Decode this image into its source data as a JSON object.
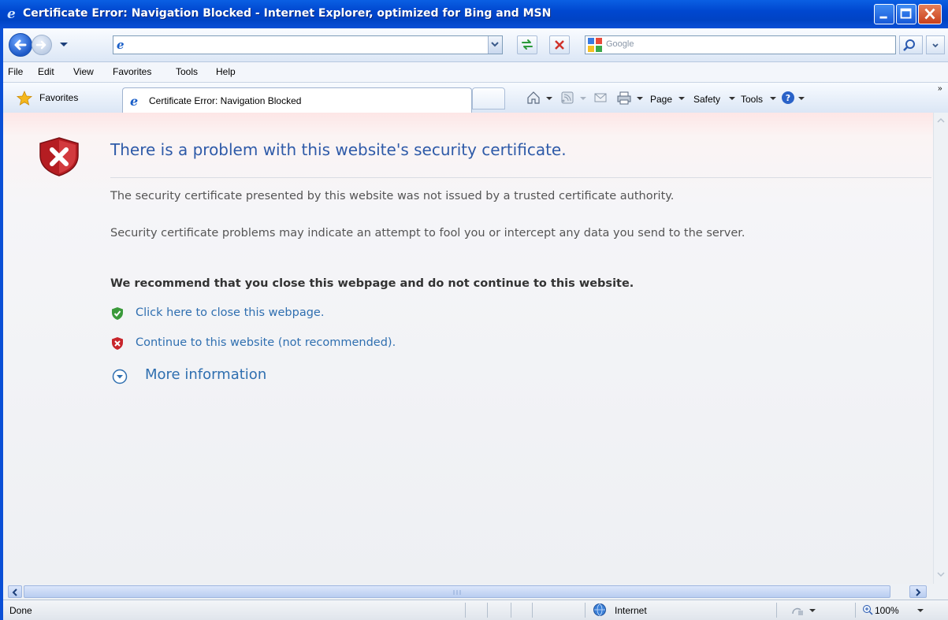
{
  "window": {
    "title": "Certificate Error: Navigation Blocked - Internet Explorer, optimized for Bing and MSN"
  },
  "address_bar": {
    "url": "",
    "search_placeholder": "Google"
  },
  "menu": [
    "File",
    "Edit",
    "View",
    "Favorites",
    "Tools",
    "Help"
  ],
  "favorites_bar": {
    "favorites_label": "Favorites",
    "tab_label": "Certificate Error: Navigation Blocked"
  },
  "command_bar": {
    "page_label": "Page",
    "safety_label": "Safety",
    "tools_label": "Tools"
  },
  "content": {
    "heading": "There is a problem with this website's security certificate.",
    "para1": "The security certificate presented by this website was not issued by a trusted certificate authority.",
    "para2": "Security certificate problems may indicate an attempt to fool you or intercept any data you send to the server.",
    "recommendation": "We recommend that you close this webpage and do not continue to this website.",
    "close_link": "Click here to close this webpage.",
    "continue_link": "Continue to this website (not recommended).",
    "more_info": "More information"
  },
  "status_bar": {
    "status": "Done",
    "zone": "Internet",
    "zoom": "100%"
  },
  "colors": {
    "title_blue": "#0047cf",
    "link_blue": "#2f6fb0",
    "heading_blue": "#2e5aa8",
    "error_red": "#c8252b",
    "ok_green": "#3a9a3a"
  },
  "icons": [
    "ie-logo-icon",
    "back-icon",
    "forward-icon",
    "refresh-icon",
    "stop-icon",
    "google-logo-icon",
    "search-icon",
    "favorites-star-icon",
    "home-icon",
    "feeds-icon",
    "mail-icon",
    "print-icon",
    "help-icon",
    "shield-error-icon",
    "shield-ok-icon",
    "shield-x-icon",
    "expand-icon",
    "globe-icon",
    "zoom-icon"
  ]
}
